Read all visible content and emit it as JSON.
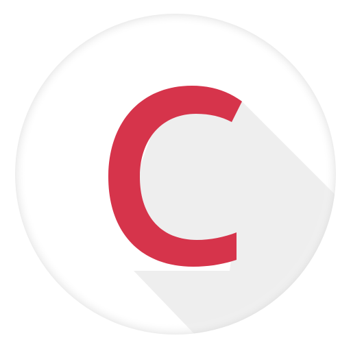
{
  "icon": {
    "glyph": "C",
    "name": "c-letter-app-icon",
    "colors": {
      "background": "#ffffff",
      "circle": "#ffffff",
      "circle_edge": "#e6e6e6",
      "long_shadow": "#eeeeee",
      "letter": "#d6344b"
    }
  }
}
